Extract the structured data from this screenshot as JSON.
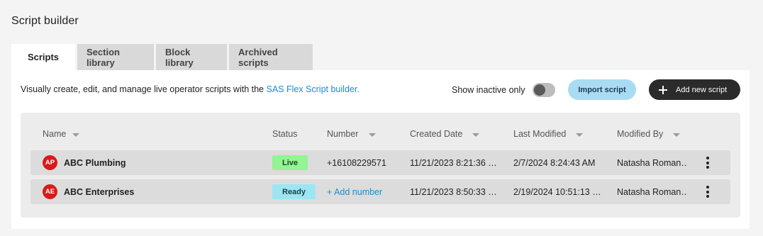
{
  "page": {
    "title": "Script builder"
  },
  "tabs": [
    {
      "label": "Scripts",
      "active": true
    },
    {
      "label": "Section library",
      "active": false
    },
    {
      "label": "Block library",
      "active": false
    },
    {
      "label": "Archived scripts",
      "active": false
    }
  ],
  "toolbar": {
    "description_prefix": "Visually create, edit, and manage live operator scripts with the ",
    "description_link": "SAS Flex Script builder.",
    "show_inactive_label": "Show inactive only",
    "show_inactive_on": false,
    "import_label": "Import script",
    "add_label": "Add new script"
  },
  "table": {
    "columns": [
      "Name",
      "Status",
      "Number",
      "Created Date",
      "Last Modified",
      "Modified By"
    ],
    "rows": [
      {
        "initials": "AP",
        "name": "ABC Plumbing",
        "status": "Live",
        "number": "+16108229571",
        "created": "11/21/2023 8:21:36 …",
        "modified": "2/7/2024 8:24:43 AM",
        "modified_by": "Natasha Roman…"
      },
      {
        "initials": "AE",
        "name": "ABC Enterprises",
        "status": "Ready",
        "number": "+ Add number",
        "created": "11/21/2023 8:50:33 …",
        "modified": "2/19/2024 10:51:13 …",
        "modified_by": "Natasha Roman…"
      }
    ]
  },
  "colors": {
    "accent_link": "#1a8bd6",
    "avatar": "#d91a1a",
    "live_badge": "#94f394",
    "ready_badge": "#9ce6f3",
    "import_button": "#a8dcf3",
    "add_button": "#2b2b2b"
  },
  "icons": {
    "add": "plus-icon",
    "sort": "caret-down-icon",
    "row_menu": "more-vertical-icon"
  }
}
